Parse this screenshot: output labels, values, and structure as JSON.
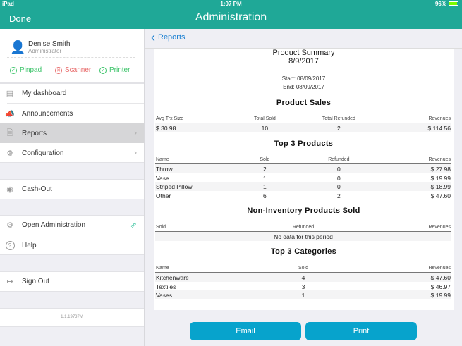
{
  "status": {
    "device": "iPad",
    "time": "1:07 PM",
    "battery": "96%"
  },
  "header": {
    "done": "Done",
    "title": "Administration"
  },
  "user": {
    "name": "Denise Smith",
    "role": "Administrator"
  },
  "devices": [
    {
      "label": "Pinpad",
      "ok": true
    },
    {
      "label": "Scanner",
      "ok": false
    },
    {
      "label": "Printer",
      "ok": true
    }
  ],
  "menu": {
    "dashboard": "My dashboard",
    "announcements": "Announcements",
    "reports": "Reports",
    "configuration": "Configuration",
    "cashout": "Cash-Out",
    "open_admin": "Open Administration",
    "help": "Help",
    "signout": "Sign Out",
    "version": "1.1.19737M"
  },
  "nav": {
    "back": "Reports"
  },
  "report": {
    "title": "Product Summary",
    "date": "8/9/2017",
    "start": "Start: 08/09/2017",
    "end": "End: 08/09/2017",
    "sales": {
      "title": "Product Sales",
      "headers": [
        "Avg Trx Size",
        "Total Sold",
        "Total Refunded",
        "Revenues"
      ],
      "rows": [
        [
          "$ 30.98",
          "10",
          "2",
          "$ 114.56"
        ]
      ]
    },
    "top_products": {
      "title": "Top 3 Products",
      "headers": [
        "Name",
        "Sold",
        "Refunded",
        "Revenues"
      ],
      "rows": [
        [
          "Throw",
          "2",
          "0",
          "$ 27.98"
        ],
        [
          "Vase",
          "1",
          "0",
          "$ 19.99"
        ],
        [
          "Striped Pillow",
          "1",
          "0",
          "$ 18.99"
        ],
        [
          "Other",
          "6",
          "2",
          "$ 47.60"
        ]
      ]
    },
    "non_inventory": {
      "title": "Non-Inventory Products Sold",
      "headers": [
        "Sold",
        "Refunded",
        "Revenues"
      ],
      "empty": "No data for this period"
    },
    "top_categories": {
      "title": "Top 3 Categories",
      "headers": [
        "Name",
        "Sold",
        "Revenues"
      ],
      "rows": [
        [
          "Kitchenware",
          "4",
          "$ 47.60"
        ],
        [
          "Textiles",
          "3",
          "$ 46.97"
        ],
        [
          "Vases",
          "1",
          "$ 19.99"
        ]
      ]
    }
  },
  "actions": {
    "email": "Email",
    "print": "Print"
  },
  "colors": {
    "teal": "#1fa897",
    "button": "#07a3cc",
    "ok": "#3cc46a",
    "error": "#e86a6a"
  }
}
